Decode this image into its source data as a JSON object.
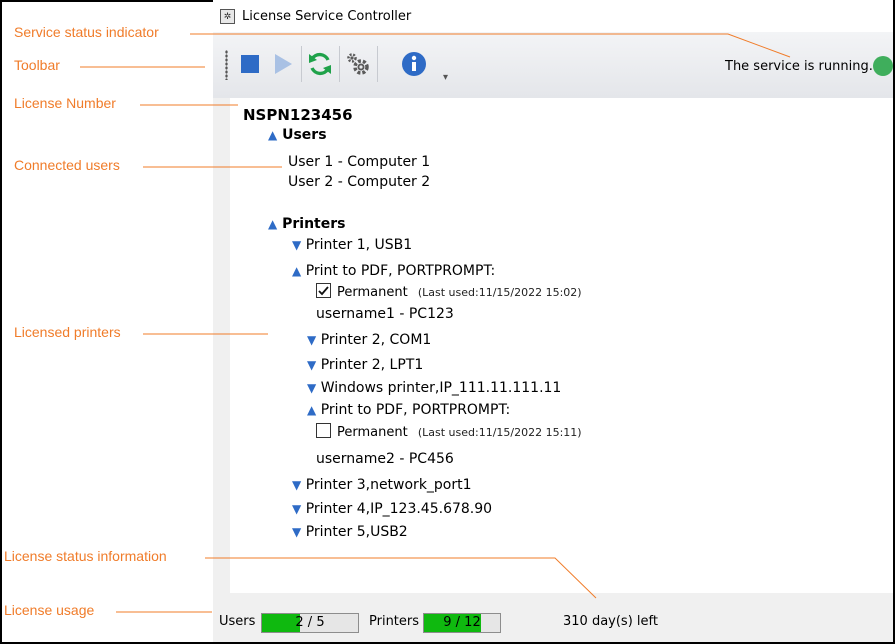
{
  "annotations": {
    "service_status": "Service status indicator",
    "toolbar": "Toolbar",
    "license_number": "License Number",
    "connected_users": "Connected users",
    "licensed_printers": "Licensed printers",
    "license_status": "License status information",
    "license_usage": "License usage"
  },
  "window": {
    "title": "License Service Controller"
  },
  "toolbar": {
    "buttons": [
      "stop-icon",
      "play-icon",
      "refresh-icon",
      "settings-icon",
      "info-icon"
    ],
    "status_text": "The service is running.",
    "status_color": "#3fae5c"
  },
  "license": {
    "number": "NSPN123456",
    "users_header": "Users",
    "users": [
      "User 1 - Computer 1",
      "User 2 - Computer 2"
    ],
    "printers_header": "Printers",
    "printers": [
      "Printer 1, USB1",
      "Print to PDF, PORTPROMPT:",
      "Printer 2, COM1",
      "Printer 2, LPT1",
      "Windows printer,IP_111.11.111.11",
      "Print to PDF, PORTPROMPT:",
      "Printer 3,network_port1",
      "Printer 4,IP_123.45.678.90",
      "Printer 5,USB2"
    ],
    "entries": [
      {
        "permanent_label": "Permanent",
        "permanent": true,
        "last_used": "(Last used:11/15/2022 15:02)",
        "user": "username1 - PC123"
      },
      {
        "permanent_label": "Permanent",
        "permanent": false,
        "last_used": "(Last used:11/15/2022 15:11)",
        "user": "username2 - PC456"
      }
    ]
  },
  "statusbar": {
    "users_label": "Users",
    "users_used": 2,
    "users_total": 5,
    "users_text": "2  /  5",
    "printers_label": "Printers",
    "printers_used": 9,
    "printers_total": 12,
    "printers_text": "9  /  12",
    "days_left": "310 day(s) left"
  },
  "colors": {
    "annotation": "#f07c2a",
    "triangle": "#2e6bc6",
    "meter_fill": "#0fb90f"
  }
}
